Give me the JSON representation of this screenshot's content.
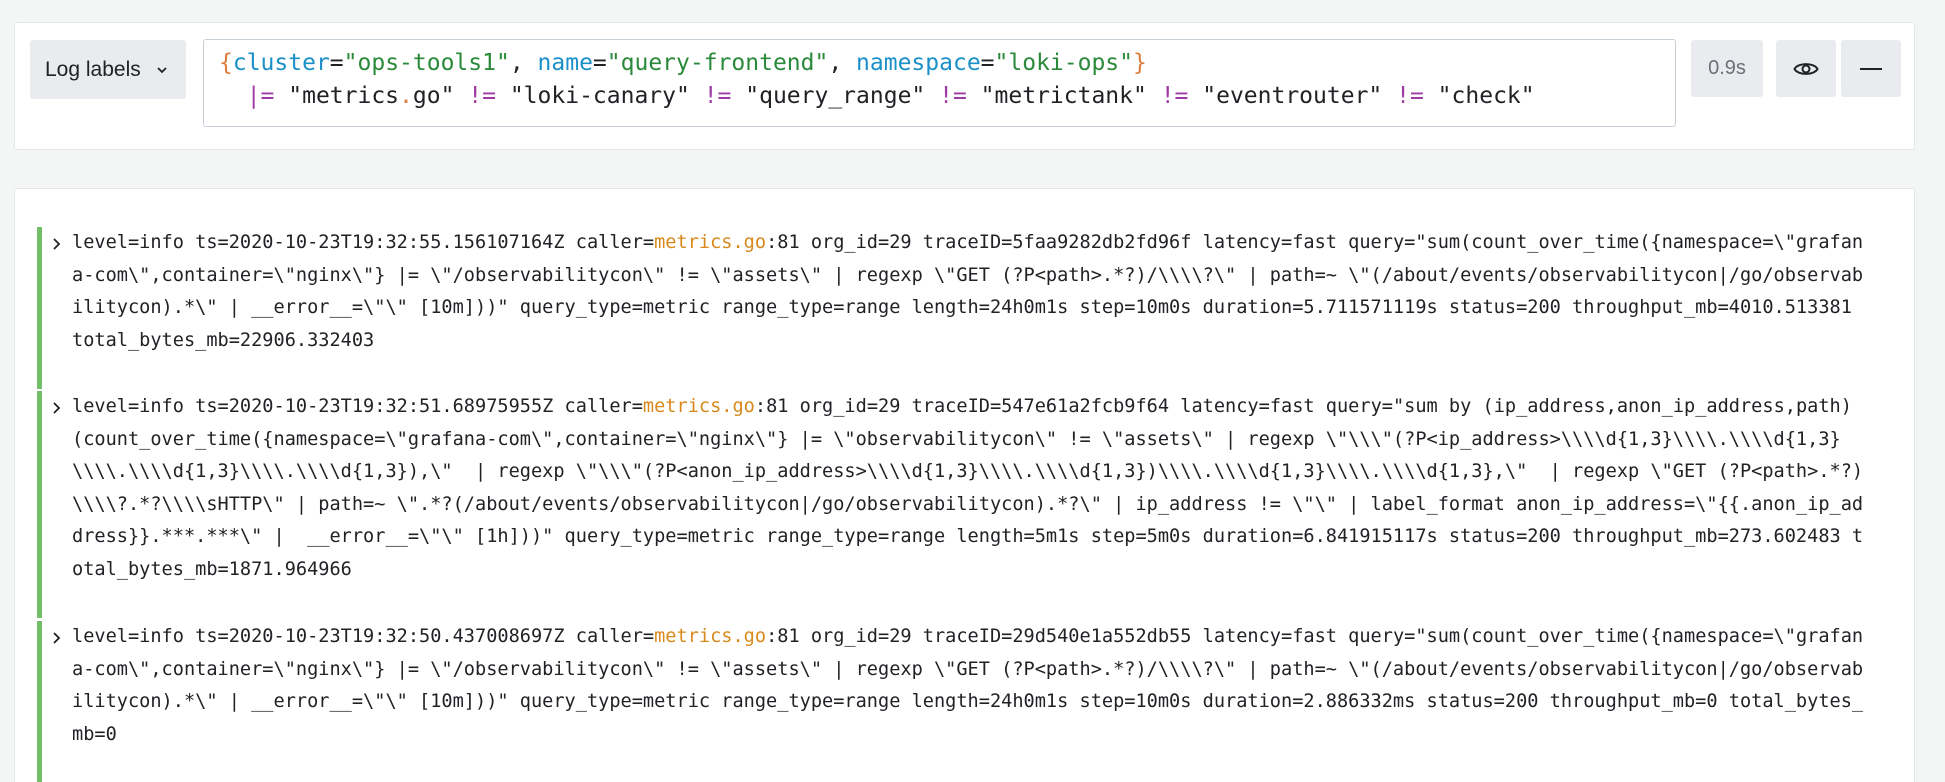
{
  "query_bar": {
    "labels_button": "Log labels",
    "line1": [
      {
        "t": "{",
        "k": "brace"
      },
      {
        "t": "cluster",
        "k": "key"
      },
      {
        "t": "=",
        "k": "default"
      },
      {
        "t": "\"ops-tools1\"",
        "k": "str"
      },
      {
        "t": ", ",
        "k": "default"
      },
      {
        "t": "name",
        "k": "key"
      },
      {
        "t": "=",
        "k": "default"
      },
      {
        "t": "\"query-frontend\"",
        "k": "str"
      },
      {
        "t": ", ",
        "k": "default"
      },
      {
        "t": "namespace",
        "k": "key"
      },
      {
        "t": "=",
        "k": "default"
      },
      {
        "t": "\"loki-ops\"",
        "k": "str"
      },
      {
        "t": "}",
        "k": "brace"
      }
    ],
    "line2": [
      {
        "t": "  ",
        "k": "default"
      },
      {
        "t": "|=",
        "k": "op"
      },
      {
        "t": " \"metrics",
        "k": "default"
      },
      {
        "t": ".",
        "k": "brace"
      },
      {
        "t": "go\" ",
        "k": "default"
      },
      {
        "t": "!=",
        "k": "op"
      },
      {
        "t": " \"loki-canary\" ",
        "k": "default"
      },
      {
        "t": "!=",
        "k": "op"
      },
      {
        "t": " \"query_range\" ",
        "k": "default"
      },
      {
        "t": "!=",
        "k": "op"
      },
      {
        "t": " \"metrictank\" ",
        "k": "default"
      },
      {
        "t": "!=",
        "k": "op"
      },
      {
        "t": " \"eventrouter\" ",
        "k": "default"
      },
      {
        "t": "!=",
        "k": "op"
      },
      {
        "t": " \"check\"",
        "k": "default"
      }
    ],
    "query_time": "0.9s",
    "icons": {
      "show": "eye-icon",
      "collapse": "minus-icon"
    }
  },
  "logs": [
    {
      "prefix": "level=info ts=2020-10-23T19:32:55.156107164Z caller=",
      "caller": "metrics.go",
      "rest": ":81 org_id=29 traceID=5faa9282db2fd96f latency=fast query=\"sum(count_over_time({namespace=\\\"grafana-com\\\",container=\\\"nginx\\\"} |= \\\"/observabilitycon\\\" != \\\"assets\\\" | regexp \\\"GET (?P<path>.*?)/\\\\\\\\?\\\" | path=~ \\\"(/about/events/observabilitycon|/go/observabilitycon).*\\\" | __error__=\\\"\\\" [10m]))\" query_type=metric range_type=range length=24h0m1s step=10m0s duration=5.711571119s status=200 throughput_mb=4010.513381 total_bytes_mb=22906.332403"
    },
    {
      "prefix": "level=info ts=2020-10-23T19:32:51.68975955Z caller=",
      "caller": "metrics.go",
      "rest": ":81 org_id=29 traceID=547e61a2fcb9f64 latency=fast query=\"sum by (ip_address,anon_ip_address,path) (count_over_time({namespace=\\\"grafana-com\\\",container=\\\"nginx\\\"} |= \\\"observabilitycon\\\" != \\\"assets\\\" | regexp \\\"\\\\\\\"(?P<ip_address>\\\\\\\\d{1,3}\\\\\\\\.\\\\\\\\d{1,3}\\\\\\\\.\\\\\\\\d{1,3}\\\\\\\\.\\\\\\\\d{1,3}),\\\"  | regexp \\\"\\\\\\\"(?P<anon_ip_address>\\\\\\\\d{1,3}\\\\\\\\.\\\\\\\\d{1,3})\\\\\\\\.\\\\\\\\d{1,3}\\\\\\\\.\\\\\\\\d{1,3},\\\"  | regexp \\\"GET (?P<path>.*?)\\\\\\\\?.*?\\\\\\\\sHTTP\\\" | path=~ \\\".*?(/about/events/observabilitycon|/go/observabilitycon).*?\\\" | ip_address != \\\"\\\" | label_format anon_ip_address=\\\"{{.anon_ip_address}}.***.***\\\" |  __error__=\\\"\\\" [1h]))\" query_type=metric range_type=range length=5m1s step=5m0s duration=6.841915117s status=200 throughput_mb=273.602483 total_bytes_mb=1871.964966"
    },
    {
      "prefix": "level=info ts=2020-10-23T19:32:50.437008697Z caller=",
      "caller": "metrics.go",
      "rest": ":81 org_id=29 traceID=29d540e1a552db55 latency=fast query=\"sum(count_over_time({namespace=\\\"grafana-com\\\",container=\\\"nginx\\\"} |= \\\"/observabilitycon\\\" != \\\"assets\\\" | regexp \\\"GET (?P<path>.*?)/\\\\\\\\?\\\" | path=~ \\\"(/about/events/observabilitycon|/go/observabilitycon).*\\\" | __error__=\\\"\\\" [10m]))\" query_type=metric range_type=range length=24h0m1s step=10m0s duration=2.886332ms status=200 throughput_mb=0 total_bytes_mb=0"
    }
  ],
  "colors": {
    "accent_green": "#73bf69",
    "caller": "#d9891b",
    "brace": "#dd7e3e",
    "key": "#1a8fc8",
    "string": "#2a8a3a",
    "operator": "#9d3aa4"
  }
}
